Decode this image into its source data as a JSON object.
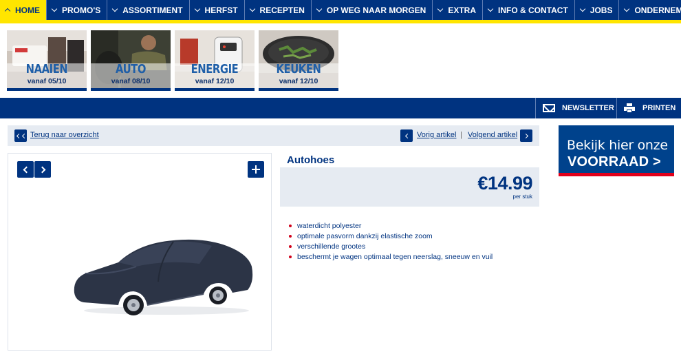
{
  "nav": {
    "items": [
      {
        "label": "HOME",
        "active": true
      },
      {
        "label": "PROMO'S"
      },
      {
        "label": "ASSORTIMENT"
      },
      {
        "label": "HERFST"
      },
      {
        "label": "RECEPTEN"
      },
      {
        "label": "OP WEG NAAR MORGEN"
      },
      {
        "label": "EXTRA"
      },
      {
        "label": "INFO & CONTACT"
      },
      {
        "label": "JOBS"
      },
      {
        "label": "ONDERNEMING"
      }
    ]
  },
  "tiles": [
    {
      "title": "NAAIEN",
      "subtitle": "vanaf 05/10"
    },
    {
      "title": "AUTO",
      "subtitle": "vanaf 08/10"
    },
    {
      "title": "ENERGIE",
      "subtitle": "vanaf 12/10"
    },
    {
      "title": "KEUKEN",
      "subtitle": "vanaf 12/10"
    }
  ],
  "utility": {
    "newsletter": "NEWSLETTER",
    "print": "PRINTEN"
  },
  "article_nav": {
    "back": "Terug naar overzicht",
    "prev": "Vorig artikel",
    "separator": "|",
    "next": "Volgend artikel"
  },
  "product": {
    "title": "Autohoes",
    "price": "€14.99",
    "unit": "per stuk",
    "features": [
      "waterdicht polyester",
      "optimale pasvorm dankzij elastische zoom",
      "verschillende grootes",
      "beschermt je wagen optimaal tegen neerslag, sneeuw en vuil"
    ]
  },
  "stock_banner": {
    "line1": "Bekijk hier onze",
    "line2": "VOORRAAD >"
  },
  "colors": {
    "brand_blue": "#003380",
    "accent_yellow": "#ffe500",
    "accent_red": "#e2001a"
  }
}
